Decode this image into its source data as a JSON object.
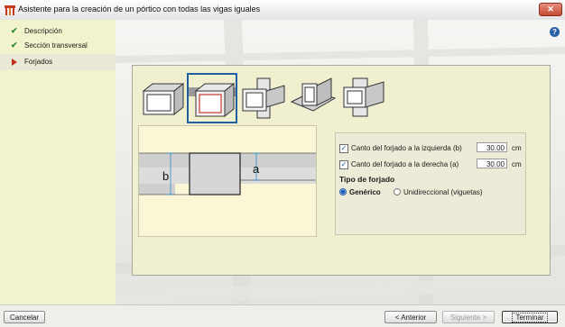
{
  "window": {
    "title": "Asistente para la creación de un pórtico con todas las vigas iguales",
    "close_glyph": "✕"
  },
  "sidebar": {
    "steps": [
      {
        "label": "Descripción",
        "state": "done",
        "icon": "checkmark-icon"
      },
      {
        "label": "Sección transversal",
        "state": "done",
        "icon": "checkmark-icon"
      },
      {
        "label": "Forjados",
        "state": "current",
        "icon": "arrow-right-icon"
      }
    ],
    "check_glyph": "✔"
  },
  "help": {
    "glyph": "?"
  },
  "thumbnails": [
    {
      "name": "floor-type-1",
      "selected": false
    },
    {
      "name": "floor-type-2",
      "selected": true
    },
    {
      "name": "floor-type-3",
      "selected": false
    },
    {
      "name": "floor-type-4",
      "selected": false
    },
    {
      "name": "floor-type-5",
      "selected": false
    }
  ],
  "diagram": {
    "label_left": "b",
    "label_right": "a"
  },
  "options": {
    "left": {
      "label": "Canto del forjado a la izquierda (b)",
      "value": "30.00",
      "unit": "cm",
      "checked": true
    },
    "right": {
      "label": "Canto del forjado a la derecha (a)",
      "value": "30.00",
      "unit": "cm",
      "checked": true
    },
    "tipo_heading": "Tipo de forjado",
    "radio_generic": {
      "label": "Genérico",
      "selected": true
    },
    "radio_unidir": {
      "label": "Unidireccional (viguetas)",
      "selected": false
    },
    "check_glyph": "✓"
  },
  "buttons": {
    "cancel": "Cancelar",
    "previous": "< Anterior",
    "next": "Siguiente >",
    "finish": "Terminar"
  },
  "colors": {
    "sidebar_bg": "#f2f2cc",
    "panel_bg": "#f0f0d0",
    "selected_border": "#1f5fa0",
    "close_red": "#c44a33"
  }
}
